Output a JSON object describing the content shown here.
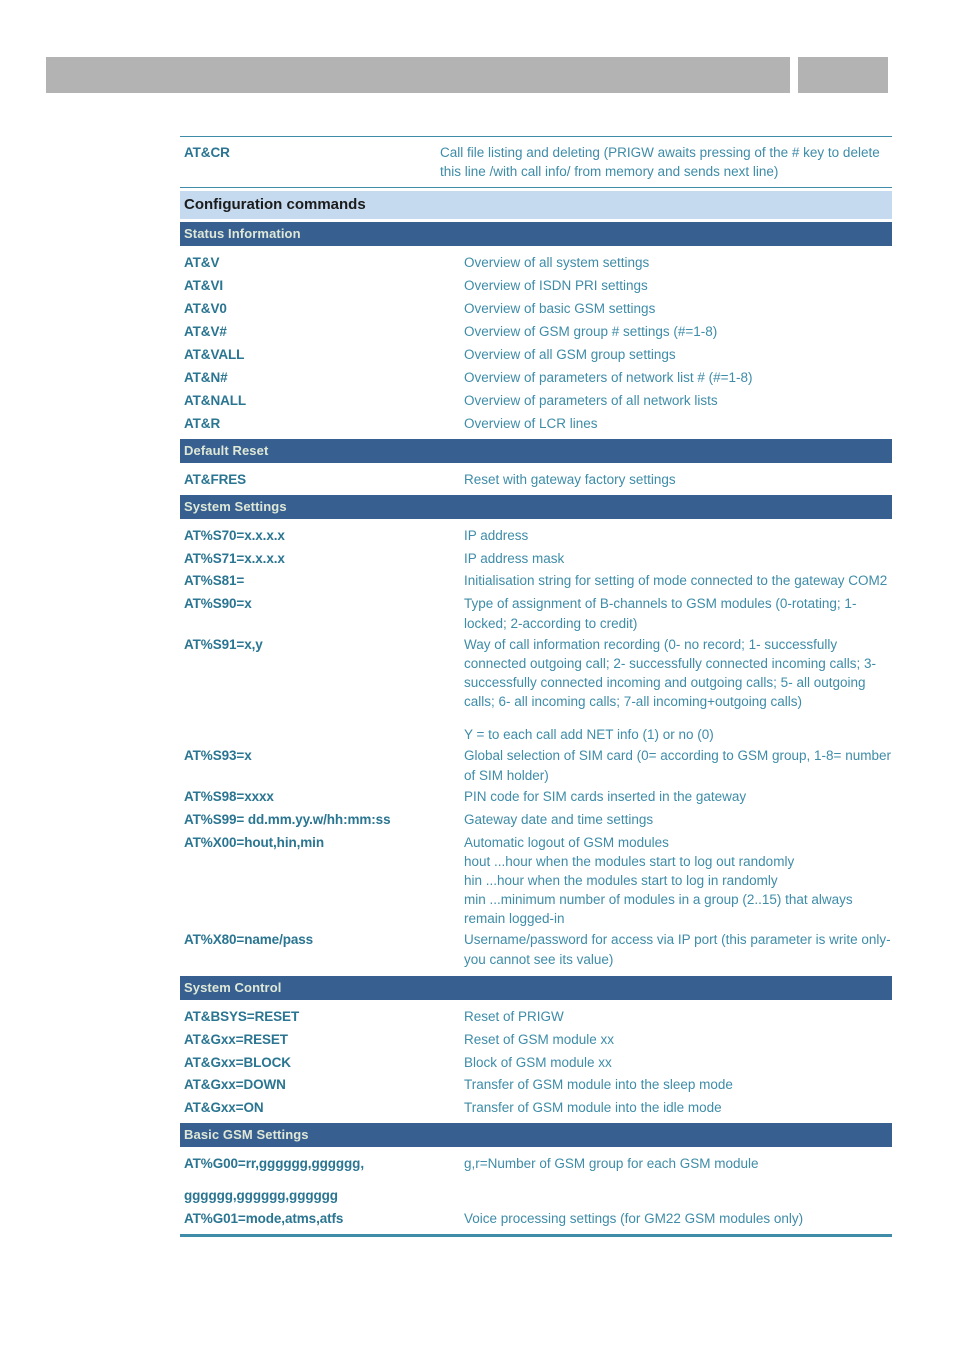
{
  "header": {
    "bar_color": "#b3b3b3",
    "left_block_label": "",
    "right_block_label": ""
  },
  "colors": {
    "command_text": "#2a7591",
    "description_text": "#3e8ca8",
    "rule": "#3e8ca8",
    "band_major_bg": "#c5d9ef",
    "band_major_text": "#1b1b1b",
    "band_section_bg": "#376090",
    "band_section_text": "#dfe8d7",
    "header_bar": "#b3b3b3"
  },
  "top_row": {
    "command": "AT&CR",
    "description": "Call file listing and deleting (PRIGW awaits pressing of the # key to delete this line /with call info/ from memory and sends next line)"
  },
  "major_heading": "Configuration commands",
  "sections": [
    {
      "title": "Status Information",
      "rows": [
        {
          "command": "AT&V",
          "description": "Overview of all system settings"
        },
        {
          "command": "AT&VI",
          "description": "Overview of ISDN PRI settings"
        },
        {
          "command": "AT&V0",
          "description": "Overview of basic GSM settings"
        },
        {
          "command": "AT&V#",
          "description": "Overview of GSM group # settings (#=1-8)"
        },
        {
          "command": "AT&VALL",
          "description": "Overview of all GSM group settings"
        },
        {
          "command": "AT&N#",
          "description": "Overview of parameters of network list # (#=1-8)"
        },
        {
          "command": "AT&NALL",
          "description": "Overview of parameters of all network lists"
        },
        {
          "command": "AT&R",
          "description": "Overview of LCR lines"
        }
      ]
    },
    {
      "title": "Default Reset",
      "rows": [
        {
          "command": "AT&FRES",
          "description": "Reset with gateway factory settings"
        }
      ]
    },
    {
      "title": "System Settings",
      "rows": [
        {
          "command": "AT%S70=x.x.x.x",
          "description": "IP address"
        },
        {
          "command": "AT%S71=x.x.x.x",
          "description": "IP address mask"
        },
        {
          "command": "AT%S81=",
          "description": "Initialisation string for setting of mode connected to the gateway COM2"
        },
        {
          "command": "AT%S90=x",
          "description": "Type of assignment of B-channels to GSM modules  (0-rotating; 1-locked; 2-according to credit)"
        },
        {
          "command": "AT%S91=x,y",
          "description": "Way of call information recording (0- no record; 1- successfully connected outgoing call; 2- successfully connected incoming calls; 3- successfully connected incoming and outgoing calls; 5- all outgoing calls; 6- all incoming calls; 7-all incoming+outgoing calls)",
          "description_extra": "Y = to each call add NET info (1) or no (0)"
        },
        {
          "command": "AT%S93=x",
          "description": "Global selection of SIM card (0= according to GSM group, 1-8= number of SIM holder)"
        },
        {
          "command": "AT%S98=xxxx",
          "description": "PIN code for SIM cards inserted in the gateway"
        },
        {
          "command": "AT%S99= dd.mm.yy.w/hh:mm:ss",
          "description": "Gateway date and time settings"
        },
        {
          "command": "AT%X00=hout,hin,min",
          "description": "Automatic  logout of GSM modules\nhout ...hour when the modules start to log out randomly\nhin  ...hour when the modules start to log in randomly\nmin  ...minimum number of modules  in a group (2..15) that always remain logged-in"
        },
        {
          "command": "AT%X80=name/pass",
          "description": "Username/password for access via IP port (this parameter is write only- you cannot see its value)"
        }
      ]
    },
    {
      "title": "System Control",
      "rows": [
        {
          "command": "AT&BSYS=RESET",
          "description": "Reset of PRIGW"
        },
        {
          "command": "AT&Gxx=RESET",
          "description": "Reset of GSM module xx"
        },
        {
          "command": "AT&Gxx=BLOCK",
          "description": "Block of GSM module xx"
        },
        {
          "command": "AT&Gxx=DOWN",
          "description": "Transfer of GSM module into the sleep mode"
        },
        {
          "command": "AT&Gxx=ON",
          "description": "Transfer of GSM module into the idle mode"
        }
      ]
    },
    {
      "title": "Basic GSM Settings",
      "rows": [
        {
          "command": "AT%G00=rr,gggggg,gggggg,",
          "command_cont": "gggggg,gggggg,gggggg",
          "description": "g,r=Number of GSM group for each GSM module"
        },
        {
          "command": "AT%G01=mode,atms,atfs",
          "description": "Voice processing settings (for GM22 GSM modules only)"
        }
      ]
    }
  ]
}
